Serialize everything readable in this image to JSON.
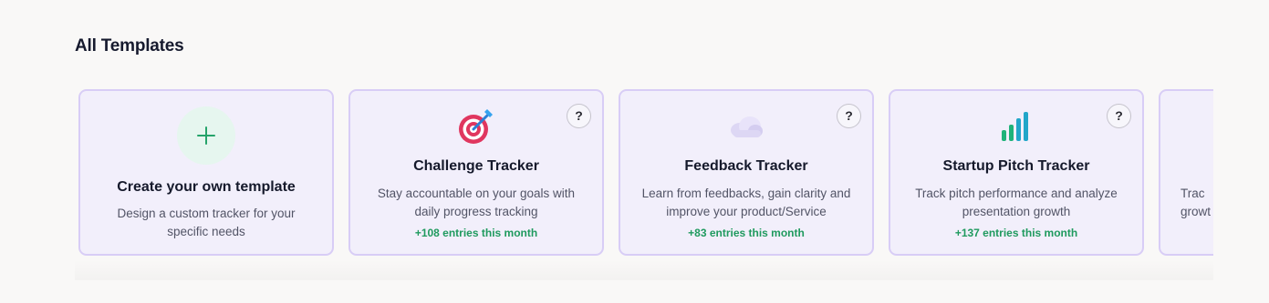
{
  "section": {
    "title": "All Templates"
  },
  "create_card": {
    "title": "Create your own template",
    "description": "Design a custom tracker for your specific needs",
    "icon": "plus-icon"
  },
  "templates": [
    {
      "title": "Challenge Tracker",
      "description": "Stay accountable on your goals with daily progress tracking",
      "stat": "+108 entries this month",
      "icon": "target-dart-icon",
      "help": "?"
    },
    {
      "title": "Feedback Tracker",
      "description": "Learn from feedbacks, gain clarity and improve your product/Service",
      "stat": "+83 entries this month",
      "icon": "cloud-icon",
      "help": "?"
    },
    {
      "title": "Startup Pitch Tracker",
      "description": "Track pitch performance and analyze presentation growth",
      "stat": "+137 entries this month",
      "icon": "bar-chart-icon",
      "help": "?"
    },
    {
      "description": "Trac growt",
      "icon": ""
    }
  ],
  "colors": {
    "card_bg": "#f2effb",
    "card_border": "#d8cdf6",
    "stat_green": "#1f9a5e",
    "plus_green": "#25a36a"
  }
}
